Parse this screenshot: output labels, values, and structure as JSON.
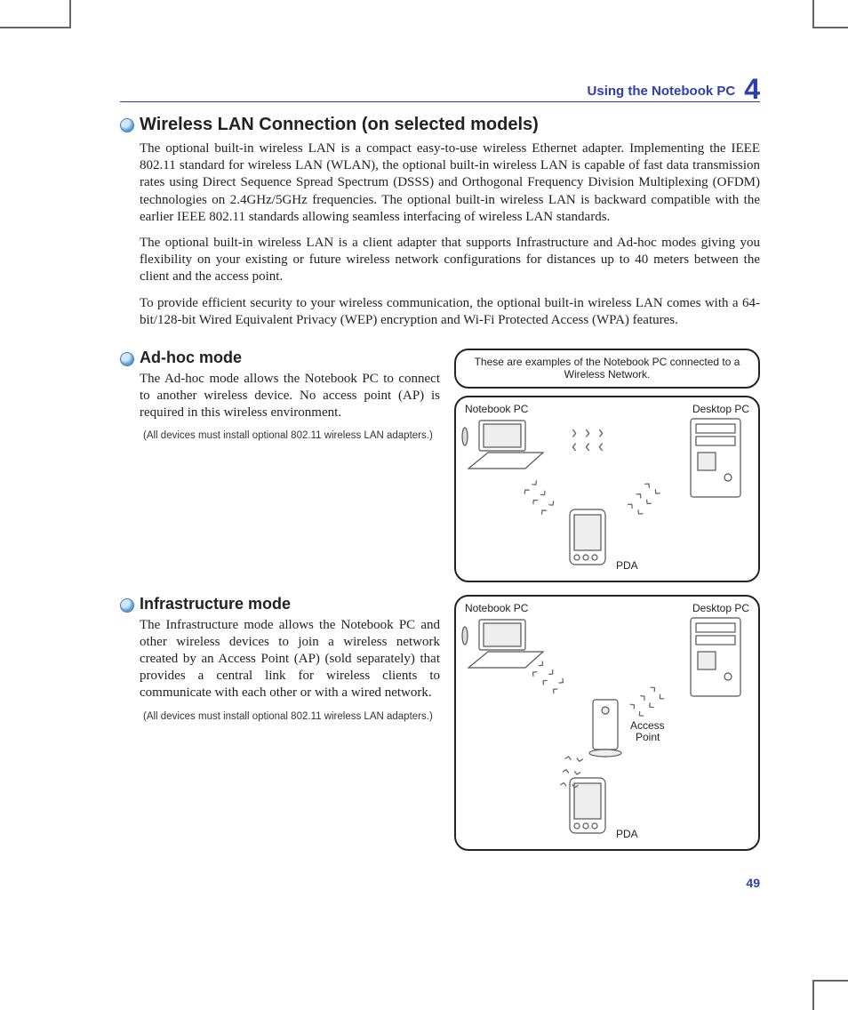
{
  "header": {
    "section": "Using the Notebook PC",
    "chapter_number": "4"
  },
  "main_title": "Wireless LAN Connection (on selected models)",
  "paragraphs": {
    "p1": "The optional built-in wireless LAN is a compact easy-to-use wireless Ethernet adapter. Implementing the IEEE 802.11 standard for wireless LAN (WLAN), the optional built-in wireless LAN is capable of fast data transmission rates using Direct Sequence Spread Spectrum (DSSS) and Orthogonal Frequency Division Multiplexing (OFDM) technologies on 2.4GHz/5GHz frequencies. The optional built-in wireless LAN is backward compatible with the earlier IEEE 802.11 standards allowing seamless interfacing of wireless LAN standards.",
    "p2": "The optional built-in wireless LAN is a client adapter that supports Infrastructure and Ad-hoc modes giving you flexibility on your existing or future wireless network configurations for distances up to 40 meters between the client and the access point.",
    "p3": "To provide efficient security to your wireless communication, the optional built-in wireless LAN comes with a 64-bit/128-bit Wired Equivalent Privacy (WEP) encryption and Wi-Fi Protected Access (WPA) features."
  },
  "adhoc": {
    "title": "Ad-hoc mode",
    "body": "The Ad-hoc mode allows the Notebook PC to connect to another wireless device. No access point (AP) is required in this wireless environment.",
    "note": "(All devices must install optional 802.11 wireless LAN adapters.)"
  },
  "infra": {
    "title": "Infrastructure mode",
    "body": "The Infrastructure mode allows the Notebook PC and other wireless devices to join a wireless network created by an Access Point (AP) (sold separately) that provides a central link for wireless clients to communicate with each other or with a wired network.",
    "note": "(All devices must install optional 802.11 wireless LAN adapters.)"
  },
  "caption": "These are examples of the Notebook PC connected to a Wireless Network.",
  "labels": {
    "notebook": "Notebook PC",
    "desktop": "Desktop PC",
    "pda": "PDA",
    "ap_line1": "Access",
    "ap_line2": "Point"
  },
  "page_number": "49"
}
